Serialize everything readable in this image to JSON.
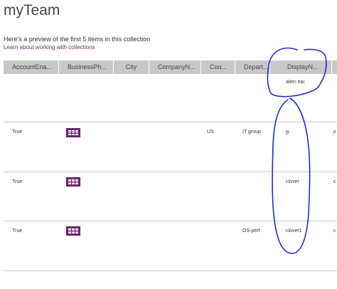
{
  "title": "myTeam",
  "preview_text": "Here's a preview of the first 5 items in this collection",
  "learn_link": "Learn about working with collections",
  "columns": [
    "AccountEna...",
    "BusinessPh...",
    "City",
    "CompanyN...",
    "Cou...",
    "Depart...",
    "DisplayN...",
    ""
  ],
  "rows": [
    {
      "account": "",
      "business_icon": false,
      "city": "",
      "company": "",
      "country": "",
      "department": "",
      "display": "allen bai",
      "extra": ""
    },
    {
      "account": "True",
      "business_icon": true,
      "city": "",
      "company": "",
      "country": "US",
      "department": "IT group",
      "display": "jy",
      "extra": "ji"
    },
    {
      "account": "True",
      "business_icon": true,
      "city": "",
      "company": "",
      "country": "",
      "department": "",
      "display": "clover",
      "extra": "c"
    },
    {
      "account": "True",
      "business_icon": true,
      "city": "",
      "company": "",
      "country": "",
      "department": "OS-perf",
      "display": "clover1",
      "extra": "c"
    }
  ],
  "icons": {
    "business_phone": "table-grid-icon"
  },
  "colors": {
    "header_bg": "#c8c8c8",
    "link": "#742774",
    "annotation": "#1f2bd1",
    "icon": "#742774"
  }
}
